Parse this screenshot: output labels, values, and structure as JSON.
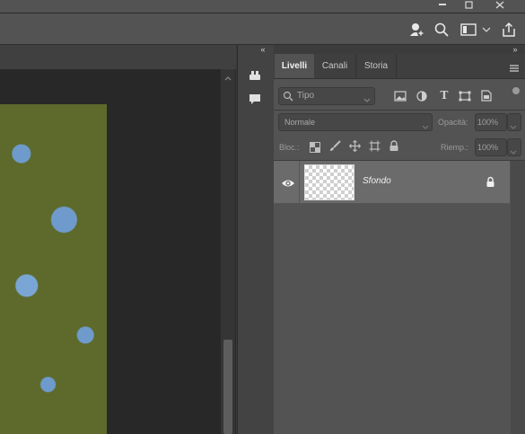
{
  "window": {
    "controls": [
      "minimize-icon",
      "restore-icon",
      "close-icon"
    ]
  },
  "options_bar": {
    "icons": [
      "share-user-icon",
      "search-icon",
      "workspace-icon",
      "chevron-down-icon",
      "export-icon"
    ]
  },
  "side_dock": {
    "collapse_glyph": "«",
    "icons": [
      "brush-settings-icon",
      "comments-icon"
    ]
  },
  "panel": {
    "collapse_glyph": "»",
    "tabs": [
      {
        "label": "Livelli",
        "active": true
      },
      {
        "label": "Canali",
        "active": false
      },
      {
        "label": "Storia",
        "active": false
      }
    ],
    "filter": {
      "placeholder": "Tipo",
      "icons": [
        "image-filter-icon",
        "adjustment-filter-icon",
        "type-filter-icon",
        "shape-filter-icon",
        "smart-object-filter-icon"
      ]
    },
    "blend": {
      "mode": "Normale",
      "opacity_label": "Opacità:",
      "opacity_value": "100%"
    },
    "lock": {
      "label": "Bloc.:",
      "icons": [
        "lock-transparent-icon",
        "lock-image-icon",
        "lock-position-icon",
        "lock-artboard-icon",
        "lock-all-icon"
      ],
      "fill_label": "Riemp.:",
      "fill_value": "100%"
    },
    "layers": [
      {
        "name": "Sfondo",
        "visible": true,
        "locked": true
      }
    ]
  },
  "colors": {
    "accent_tab": "#535353",
    "layer_selected": "#6b6b6b"
  }
}
